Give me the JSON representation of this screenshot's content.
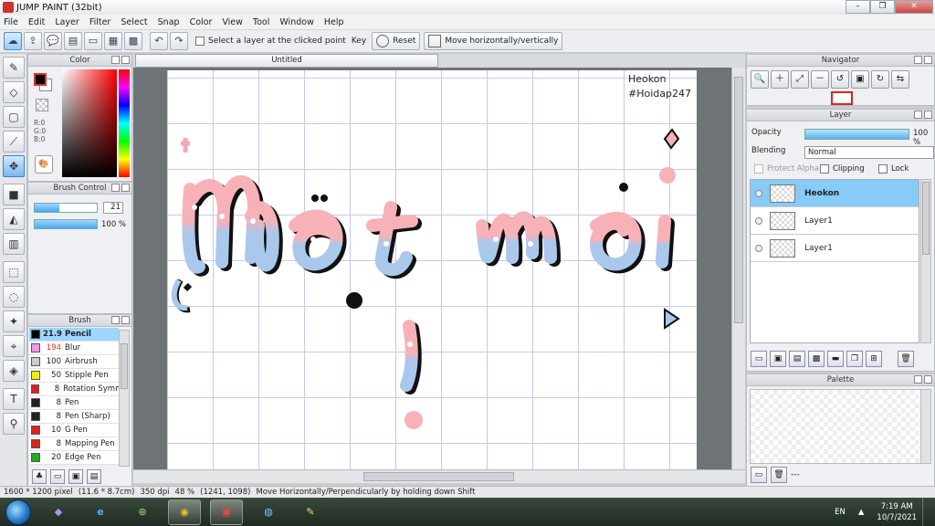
{
  "window": {
    "title": "JUMP PAINT (32bit)"
  },
  "menu": [
    "File",
    "Edit",
    "Layer",
    "Filter",
    "Select",
    "Snap",
    "Color",
    "View",
    "Tool",
    "Window",
    "Help"
  ],
  "toolbar": {
    "select_layer_label": "Select a layer at the clicked point",
    "key_label": "Key",
    "reset_label": "Reset",
    "move_label": "Move horizontally/vertically"
  },
  "color_panel": {
    "title": "Color",
    "r": "R:0",
    "g": "G:0",
    "b": "B:0",
    "fg_color": "#000000",
    "bg_color": "#ffffff"
  },
  "brush_control": {
    "title": "Brush Control",
    "size": "21",
    "opacity": "100 %",
    "size_fraction": 0.4,
    "opacity_fraction": 1.0
  },
  "brush_panel": {
    "title": "Brush",
    "items": [
      {
        "size": "21.9",
        "name": "Pencil",
        "color": "#000000",
        "selected": true
      },
      {
        "size": "194",
        "name": "Blur",
        "color": "#ee99ee",
        "selected": false
      },
      {
        "size": "100",
        "name": "Airbrush",
        "color": "#cccccc",
        "selected": false
      },
      {
        "size": "50",
        "name": "Stipple Pen",
        "color": "#eeee00",
        "selected": false
      },
      {
        "size": "8",
        "name": "Rotation Symm",
        "color": "#dd2222",
        "selected": false
      },
      {
        "size": "8",
        "name": "Pen",
        "color": "#222222",
        "selected": false
      },
      {
        "size": "8",
        "name": "Pen (Sharp)",
        "color": "#222222",
        "selected": false
      },
      {
        "size": "10",
        "name": "G Pen",
        "color": "#dd2222",
        "selected": false
      },
      {
        "size": "8",
        "name": "Mapping Pen",
        "color": "#dd2222",
        "selected": false
      },
      {
        "size": "20",
        "name": "Edge Pen",
        "color": "#22aa22",
        "selected": false
      }
    ]
  },
  "document": {
    "tab": "Untitled",
    "author": "Heokon",
    "hashtag": "#Hoidap247"
  },
  "navigator": {
    "title": "Navigator"
  },
  "layer_panel": {
    "title": "Layer",
    "opacity_label": "Opacity",
    "opacity_value": "100 %",
    "blending_label": "Blending",
    "blending_value": "Normal",
    "protect_alpha": "Protect Alpha",
    "clipping": "Clipping",
    "lock": "Lock",
    "layers": [
      {
        "name": "Heokon",
        "selected": true
      },
      {
        "name": "Layer1",
        "selected": false
      },
      {
        "name": "Layer1",
        "selected": false
      }
    ]
  },
  "palette_panel": {
    "title": "Palette",
    "footer": "---"
  },
  "status": {
    "size": "1600 * 1200 pixel",
    "cm": "(11.6 * 8.7cm)",
    "dpi": "350 dpi",
    "zoom": "48 %",
    "coords": "(1241, 1098)",
    "hint": "Move Horizontally/Perpendicularly by holding down Shift"
  },
  "taskbar": {
    "lang": "EN",
    "time": "7:19 AM",
    "date": "10/7/2021"
  }
}
